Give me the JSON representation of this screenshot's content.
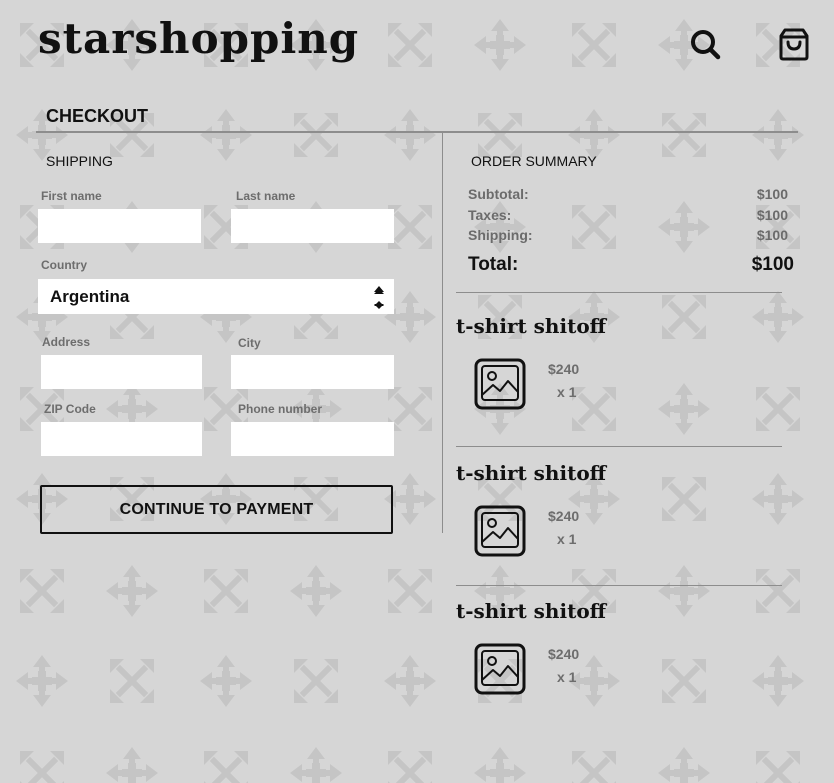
{
  "header": {
    "logo": "starshopping",
    "search_icon": "search-icon",
    "cart_icon": "shopping-bag-icon"
  },
  "page_title": "CHECKOUT",
  "shipping": {
    "title": "SHIPPING",
    "first_name_label": "First name",
    "last_name_label": "Last name",
    "country_label": "Country",
    "country_value": "Argentina",
    "address_label": "Address",
    "city_label": "City",
    "zip_label": "ZIP Code",
    "phone_label": "Phone number",
    "submit_label": "CONTINUE TO PAYMENT"
  },
  "summary": {
    "title": "ORDER SUMMARY",
    "subtotal_label": "Subtotal:",
    "subtotal_value": "$100",
    "taxes_label": "Taxes:",
    "taxes_value": "$100",
    "shipping_label": "Shipping:",
    "shipping_value": "$100",
    "total_label": "Total:",
    "total_value": "$100"
  },
  "items": [
    {
      "name": "t-shirt shitoff",
      "price": "$240",
      "qty": "x 1",
      "thumb_icon": "image-placeholder-icon"
    },
    {
      "name": "t-shirt shitoff",
      "price": "$240",
      "qty": "x 1",
      "thumb_icon": "image-placeholder-icon"
    },
    {
      "name": "t-shirt shitoff",
      "price": "$240",
      "qty": "x 1",
      "thumb_icon": "image-placeholder-icon"
    }
  ],
  "colors": {
    "background": "#d6d6d6",
    "pattern": "#c4c4c4",
    "text": "#111111",
    "muted_text": "#6d6d6d",
    "input_bg": "#ffffff"
  }
}
